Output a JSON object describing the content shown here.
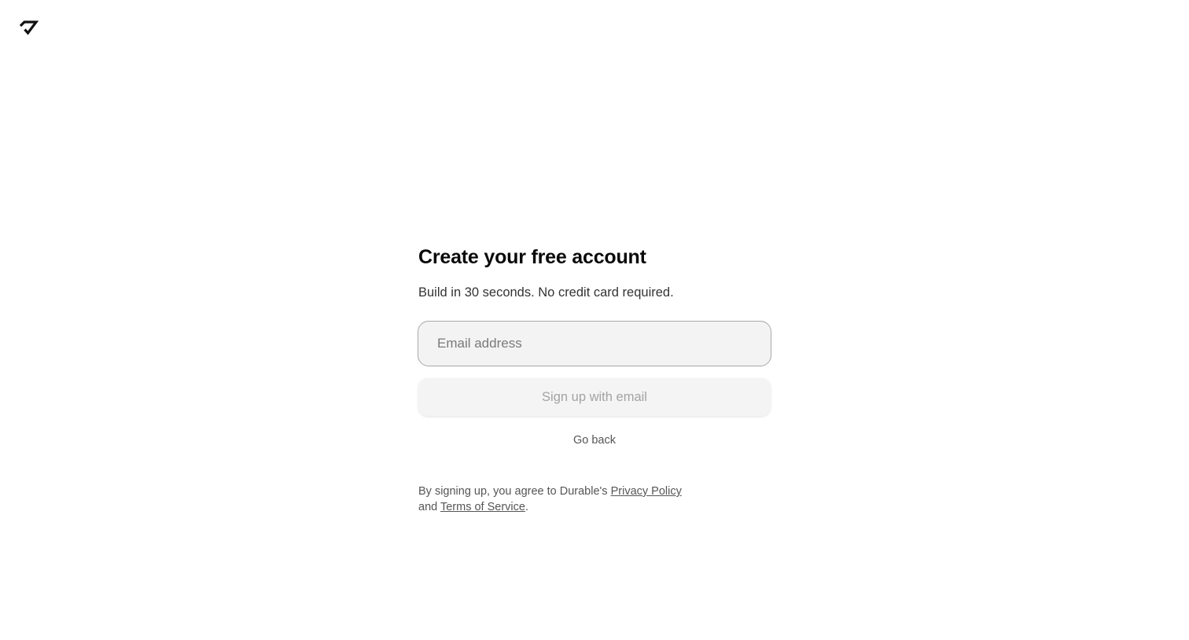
{
  "header": {
    "logo_icon": "durable-logo-icon"
  },
  "signup": {
    "title": "Create your free account",
    "subtitle": "Build in 30 seconds. No credit card required.",
    "email_placeholder": "Email address",
    "email_value": "",
    "submit_label": "Sign up with email",
    "go_back_label": "Go back",
    "legal": {
      "prefix": "By signing up, you agree to Durable's ",
      "privacy_label": "Privacy Policy",
      "middle": "and ",
      "terms_label": "Terms of Service",
      "suffix": "."
    }
  },
  "colors": {
    "background": "#ffffff",
    "input_background": "#f3f3f3",
    "input_border": "#a8a8a8",
    "button_background": "#f4f4f4",
    "button_text_disabled": "#a3a3a3"
  }
}
